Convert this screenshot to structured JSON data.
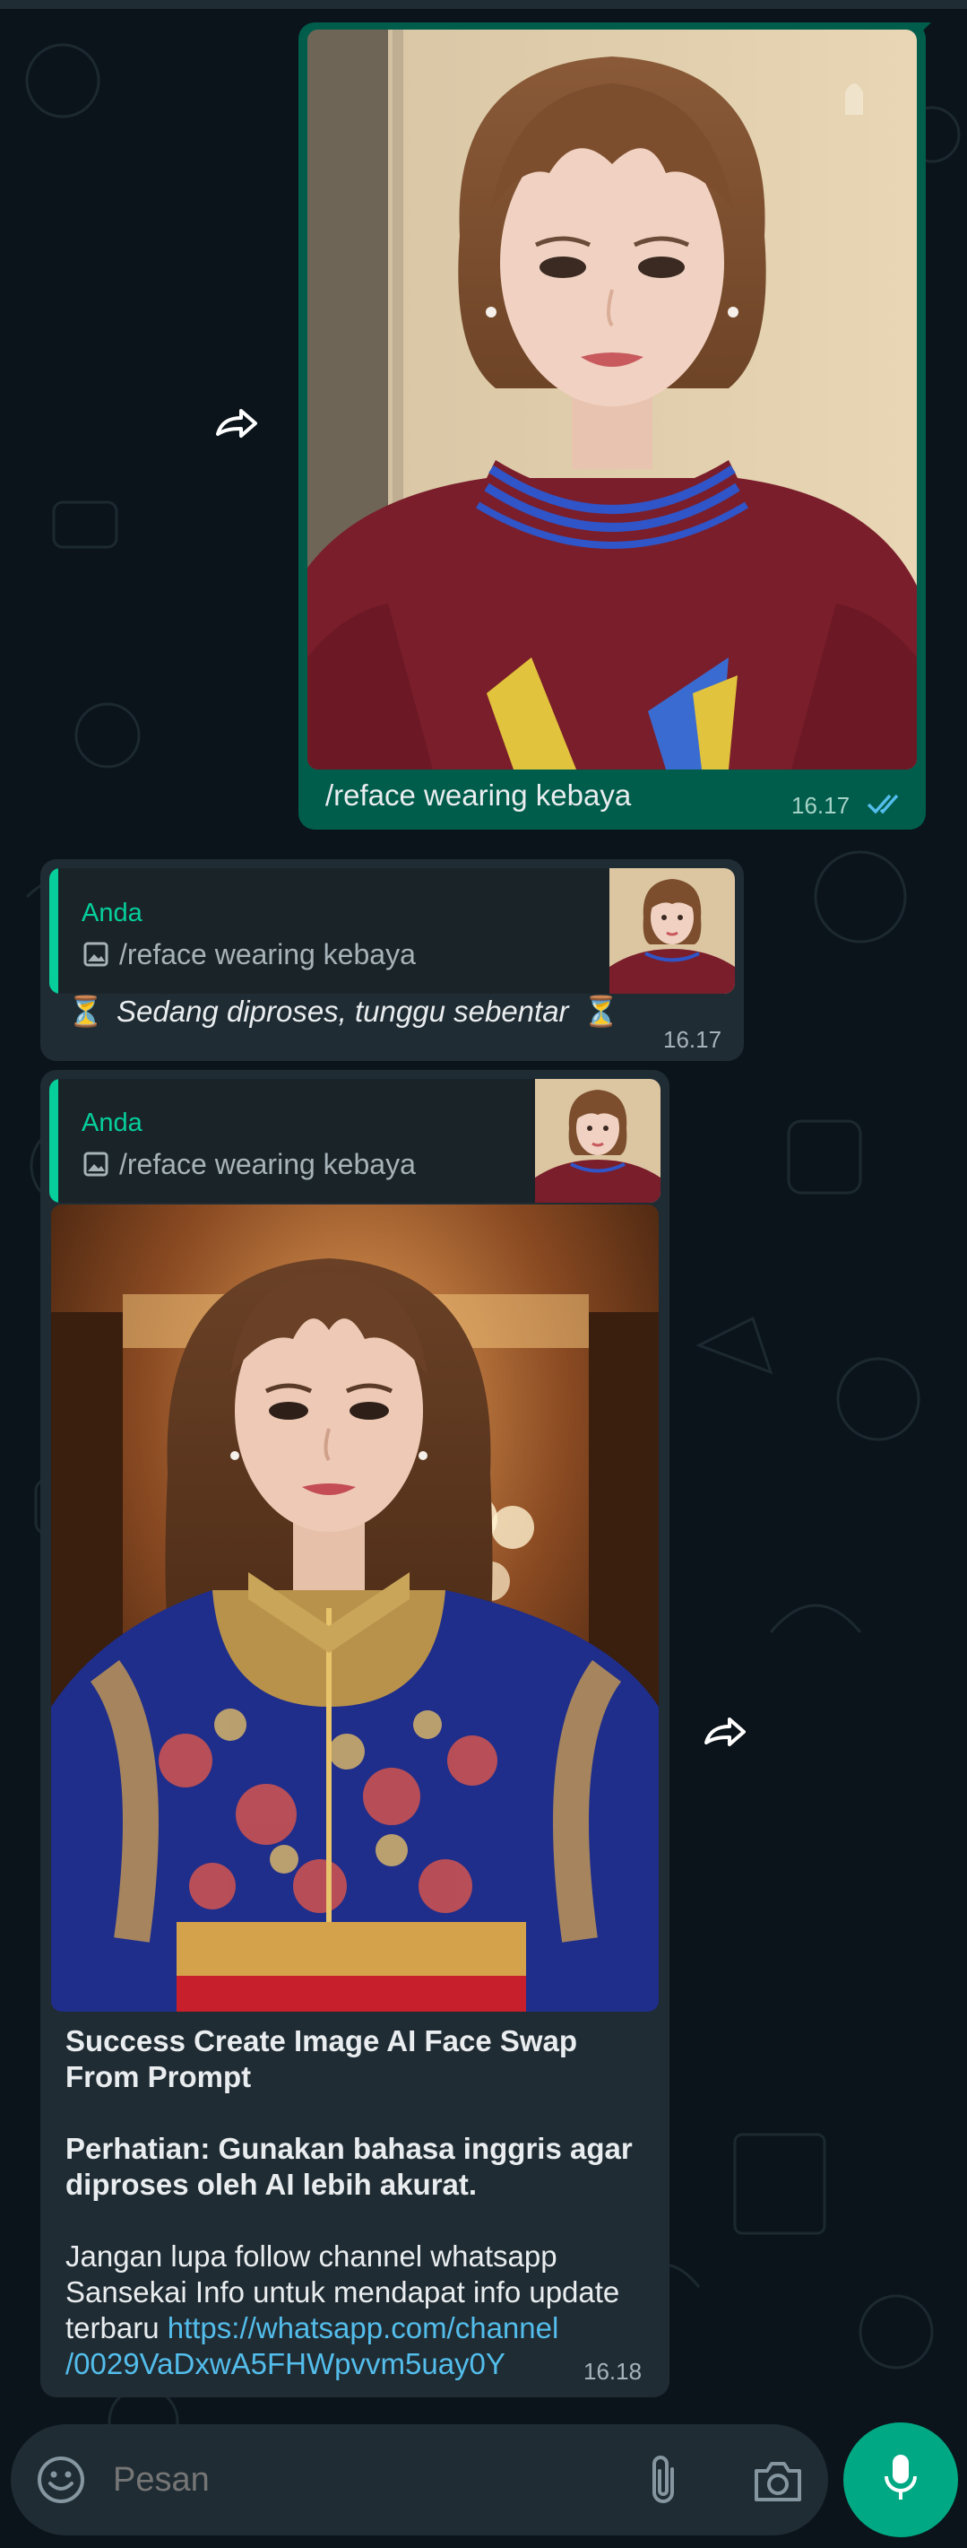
{
  "messages": [
    {
      "direction": "outgoing",
      "caption": "/reface wearing kebaya",
      "time": "16.17",
      "status": "read"
    },
    {
      "direction": "incoming",
      "quote_sender": "Anda",
      "quote_text": "/reface wearing kebaya",
      "text": "Sedang diproses, tunggu sebentar",
      "emoji": "⏳",
      "time": "16.17"
    },
    {
      "direction": "incoming",
      "quote_sender": "Anda",
      "quote_text": "/reface wearing kebaya",
      "title": "Success Create Image AI Face Swap From Prompt",
      "notice": "Perhatian: Gunakan bahasa inggris agar diproses oleh AI lebih akurat.",
      "footer": "Jangan lupa follow channel whatsapp Sansekai Info untuk mendapat info update terbaru",
      "link": "https://whatsapp.com/channel/0029VaDxwA5FHWpvvm5uay0Y",
      "link_line1": "https://whatsapp.com/channel",
      "link_line2": "/0029VaDxwA5FHWpvvm5uay0Y",
      "time": "16.18"
    }
  ],
  "composer": {
    "placeholder": "Pesan"
  },
  "colors": {
    "background": "#0b141a",
    "outgoing_bubble": "#005c4b",
    "incoming_bubble": "#202c33",
    "accent": "#00a884",
    "quote_name": "#06cf9c",
    "link": "#53bdeb",
    "read_ticks": "#53bdeb"
  }
}
